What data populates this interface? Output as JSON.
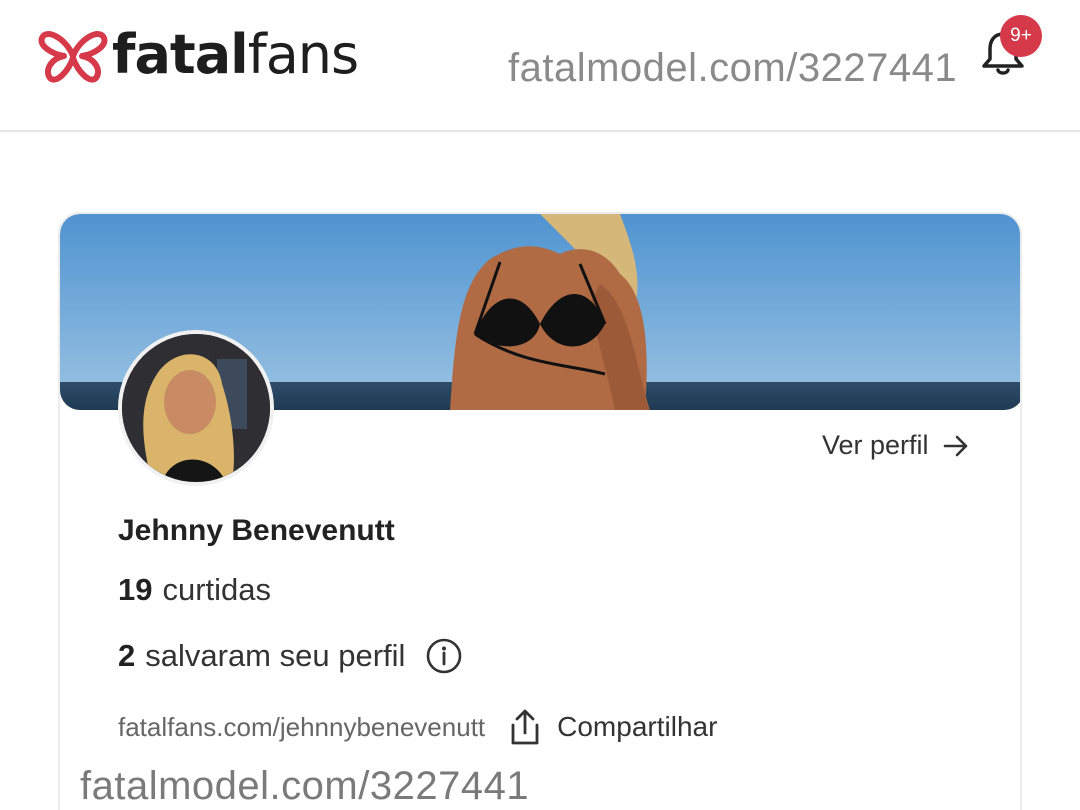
{
  "header": {
    "brand_light": "fatal",
    "brand_rest": "fans",
    "watermark": "fatalmodel.com/3227441",
    "notification_badge": "9+",
    "icons": {
      "logo": "butterfly-logo-icon",
      "bell": "bell-icon"
    }
  },
  "profile": {
    "view_profile_label": "Ver perfil",
    "name": "Jehnny Benevenutt",
    "likes_count": "19",
    "likes_label": "curtidas",
    "saves_count": "2",
    "saves_label": "salvaram seu perfil",
    "url": "fatalfans.com/jehnnybenevenutt",
    "share_label": "Compartilhar",
    "icons": {
      "arrow": "arrow-right-icon",
      "info": "info-icon",
      "share": "share-icon"
    }
  },
  "footer": {
    "watermark": "fatalmodel.com/3227441"
  },
  "colors": {
    "brand_red": "#d63a4a",
    "text_dark": "#222222",
    "text_muted": "#666666",
    "divider": "#e6e6e6"
  }
}
